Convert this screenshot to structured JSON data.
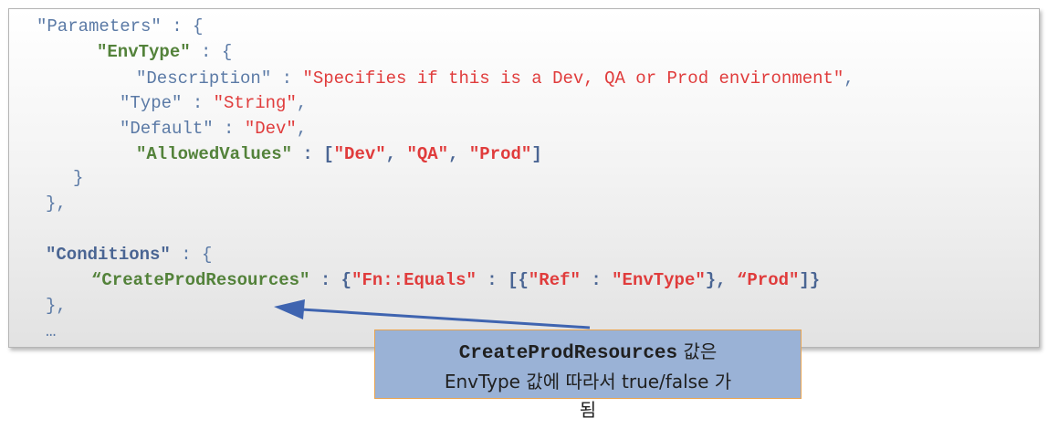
{
  "code": {
    "lines": [
      {
        "tokens": [
          {
            "t": "\"Parameters\" : {",
            "c": "k"
          }
        ]
      },
      {
        "tokens": [
          {
            "t": "\"EnvType\"",
            "c": "kb"
          },
          {
            "t": " : {",
            "c": "p"
          }
        ]
      },
      {
        "tokens": [
          {
            "t": "\"Description\" : ",
            "c": "k"
          },
          {
            "t": "\"Specifies if this is a Dev, QA or Prod environment\"",
            "c": "s"
          },
          {
            "t": ",",
            "c": "p"
          }
        ]
      },
      {
        "tokens": [
          {
            "t": "\"Type\" : ",
            "c": "k"
          },
          {
            "t": "\"String\"",
            "c": "s"
          },
          {
            "t": ",",
            "c": "p"
          }
        ]
      },
      {
        "tokens": [
          {
            "t": "\"Default\" : ",
            "c": "k"
          },
          {
            "t": "\"Dev\"",
            "c": "s"
          },
          {
            "t": ",",
            "c": "p"
          }
        ]
      },
      {
        "tokens": [
          {
            "t": "\"AllowedValues\"",
            "c": "kb"
          },
          {
            "t": " : [",
            "c": "pb"
          },
          {
            "t": "\"Dev\"",
            "c": "sb"
          },
          {
            "t": ", ",
            "c": "pb"
          },
          {
            "t": "\"QA\"",
            "c": "sb"
          },
          {
            "t": ", ",
            "c": "pb"
          },
          {
            "t": "\"Prod\"",
            "c": "sb"
          },
          {
            "t": "]",
            "c": "pb"
          }
        ]
      },
      {
        "tokens": [
          {
            "t": "}",
            "c": "p"
          }
        ]
      },
      {
        "tokens": [
          {
            "t": "},",
            "c": "p"
          }
        ]
      },
      {
        "tokens": []
      },
      {
        "tokens": [
          {
            "t": "\"Conditions\"",
            "c": "pb"
          },
          {
            "t": " : {",
            "c": "p"
          }
        ]
      },
      {
        "tokens": [
          {
            "t": "“CreateProdResources\"",
            "c": "kb"
          },
          {
            "t": " : {",
            "c": "pb"
          },
          {
            "t": "\"Fn::Equals\"",
            "c": "sb"
          },
          {
            "t": " : [{",
            "c": "pb"
          },
          {
            "t": "\"Ref\"",
            "c": "sb"
          },
          {
            "t": " : ",
            "c": "pb"
          },
          {
            "t": "\"EnvType\"",
            "c": "sb"
          },
          {
            "t": "}, ",
            "c": "pb"
          },
          {
            "t": "“Prod\"",
            "c": "sb"
          },
          {
            "t": "]}",
            "c": "pb"
          }
        ]
      },
      {
        "tokens": [
          {
            "t": "},",
            "c": "p"
          }
        ]
      },
      {
        "tokens": [
          {
            "t": "…",
            "c": "p"
          }
        ]
      }
    ]
  },
  "callout": {
    "mono": "CreateProdResources",
    "line1_rest": " 값은",
    "line2": "EnvType 값에 따라서 true/false 가",
    "line3": "됨"
  },
  "colors": {
    "key": "#5b7aa6",
    "bold_key": "#53823a",
    "string": "#e03c3c",
    "callout_bg": "#9ab2d6",
    "callout_border": "#e8a34e",
    "arrow": "#3f64b0"
  }
}
